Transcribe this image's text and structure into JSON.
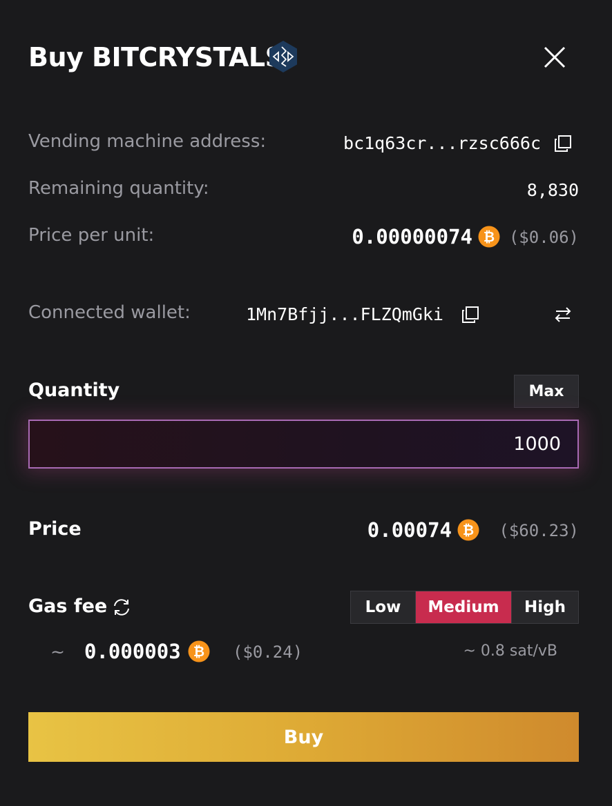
{
  "header": {
    "title": "Buy BITCRYSTALS"
  },
  "details": {
    "vending_label": "Vending machine address:",
    "vending_address": "bc1q63cr...rzsc666c",
    "remaining_label": "Remaining quantity:",
    "remaining_value": "8,830",
    "price_unit_label": "Price per unit:",
    "price_unit_btc": "0.00000074",
    "price_unit_usd": "($0.06)",
    "wallet_label": "Connected wallet:",
    "wallet_address": "1Mn7Bfjj...FLZQmGki"
  },
  "quantity": {
    "label": "Quantity",
    "max_label": "Max",
    "value": "1000"
  },
  "price": {
    "label": "Price",
    "btc": "0.00074",
    "usd": "($60.23)"
  },
  "gas": {
    "label": "Gas fee",
    "options": [
      "Low",
      "Medium",
      "High"
    ],
    "selected": "Medium",
    "approx": "~",
    "btc": "0.000003",
    "usd": "($0.24)",
    "rate": "~ 0.8 sat/vB"
  },
  "actions": {
    "buy_label": "Buy"
  },
  "colors": {
    "background": "#1a1a1c",
    "accent_selected": "#c82c4e",
    "btc_orange": "#f7931a",
    "buy_gradient_start": "#e8c344",
    "buy_gradient_end": "#cf8a2d",
    "input_border": "#a86ab4"
  },
  "icons": {
    "token": "bitcrystals-logo-icon",
    "close": "close-icon",
    "copy": "copy-icon",
    "swap": "swap-icon",
    "refresh": "refresh-icon",
    "btc": "bitcoin-icon"
  }
}
